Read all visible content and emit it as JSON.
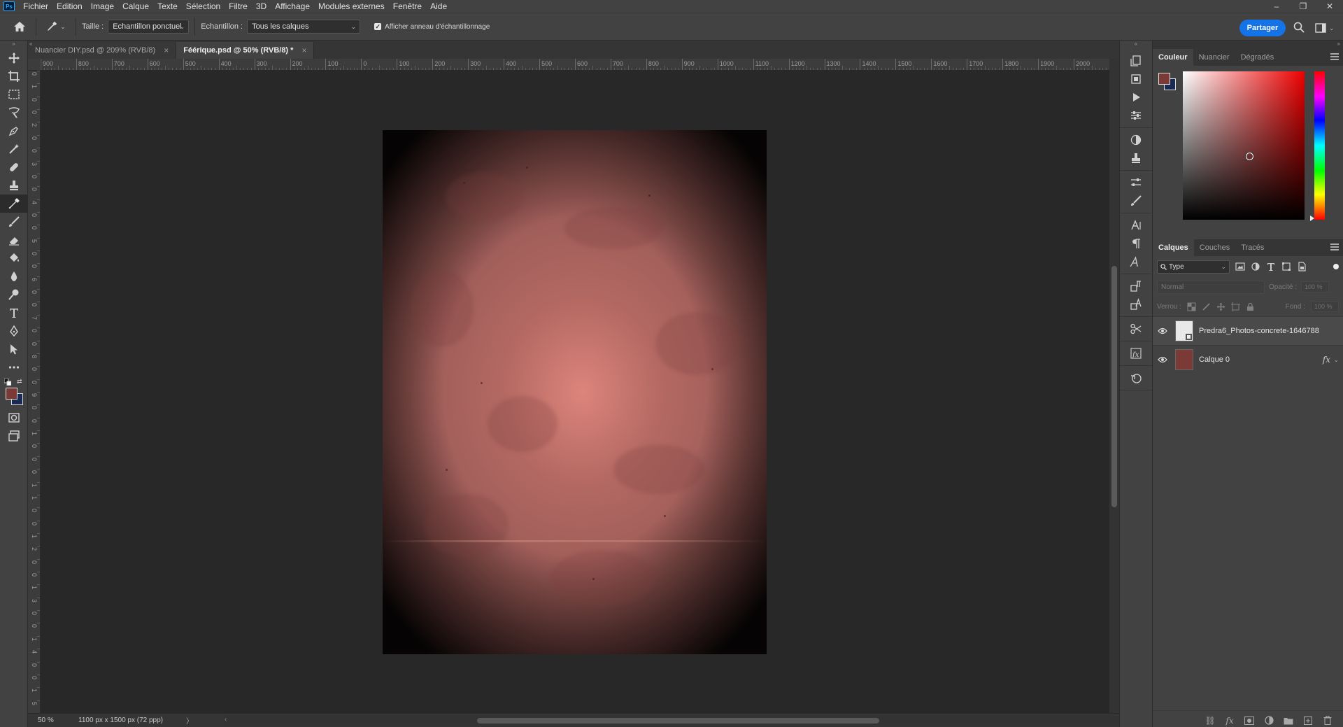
{
  "app": {
    "logo": "Ps"
  },
  "menu": [
    "Fichier",
    "Edition",
    "Image",
    "Calque",
    "Texte",
    "Sélection",
    "Filtre",
    "3D",
    "Affichage",
    "Modules externes",
    "Fenêtre",
    "Aide"
  ],
  "window_controls": {
    "minimize": "–",
    "restore": "❐",
    "close": "✕"
  },
  "options": {
    "size_label": "Taille :",
    "size_value": "Echantillon ponctuel",
    "sample_label": "Echantillon :",
    "sample_value": "Tous les calques",
    "ring_label": "Afficher anneau d'échantillonnage",
    "ring_checked": true,
    "share_label": "Partager"
  },
  "tabs": [
    {
      "label": "Nuancier DIY.psd @ 209% (RVB/8)",
      "active": false
    },
    {
      "label": "Féérique.psd @ 50% (RVB/8) *",
      "active": true
    }
  ],
  "ruler": {
    "top": [
      "900",
      "800",
      "700",
      "600",
      "500",
      "400",
      "300",
      "200",
      "100",
      "0",
      "100",
      "200",
      "300",
      "400",
      "500",
      "600",
      "700",
      "800",
      "900",
      "1000",
      "1100",
      "1200",
      "1300",
      "1400",
      "1500",
      "1600",
      "1700",
      "1800",
      "1900",
      "2000"
    ],
    "left": [
      "0",
      "1",
      "0",
      "0",
      "2",
      "0",
      "0",
      "3",
      "0",
      "0",
      "4",
      "0",
      "0",
      "5",
      "0",
      "0",
      "6",
      "0",
      "0",
      "7",
      "0",
      "0",
      "8",
      "0",
      "0",
      "9",
      "0",
      "0",
      "1",
      "0",
      "0",
      "0",
      "1",
      "1",
      "0",
      "0",
      "1",
      "2",
      "0",
      "0",
      "1",
      "3",
      "0",
      "0",
      "1",
      "4",
      "0",
      "0",
      "1",
      "5"
    ]
  },
  "status": {
    "zoom": "50 %",
    "doc_size": "1100 px x 1500 px (72 ppp)",
    "arrow": "〉"
  },
  "colors": {
    "foreground": "#7b3a36",
    "background": "#1b2a52",
    "accent": "#1473e6"
  },
  "color_panel": {
    "tabs": [
      "Couleur",
      "Nuancier",
      "Dégradés"
    ]
  },
  "layers_panel": {
    "tabs": [
      "Calques",
      "Couches",
      "Tracés"
    ],
    "filter_label": "Type",
    "blend_mode": "Normal",
    "opacity_label": "Opacité :",
    "opacity_value": "100 %",
    "lock_label": "Verrou :",
    "fill_label": "Fond :",
    "fill_value": "100 %",
    "layers": [
      {
        "name": "Predra6_Photos-concrete-1646788",
        "visible": true,
        "selected": true,
        "fx": ""
      },
      {
        "name": "Calque 0",
        "visible": true,
        "selected": false,
        "fx": "fx"
      }
    ]
  }
}
